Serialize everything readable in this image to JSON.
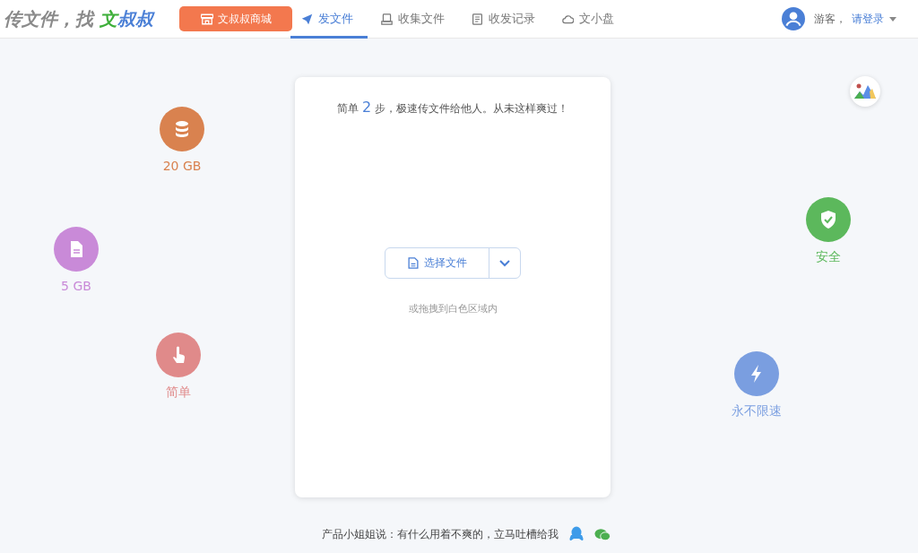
{
  "logo": [
    {
      "text": "传文件，找 ",
      "color": "#8a8a8a"
    },
    {
      "text": "文",
      "color": "#3eaf3a"
    },
    {
      "text": "叔叔",
      "color": "#4a7fd6"
    }
  ],
  "shop_button": {
    "label": "文叔叔商城"
  },
  "tabs": [
    {
      "label": "发文件",
      "selected": true
    },
    {
      "label": "收集文件",
      "selected": false
    },
    {
      "label": "收发记录",
      "selected": false
    },
    {
      "label": "文小盘",
      "selected": false
    }
  ],
  "user": {
    "greeting": "游客，",
    "login": "请登录"
  },
  "features": [
    {
      "label": "20 GB",
      "color": "#d9824f"
    },
    {
      "label": "5 GB",
      "color": "#c98ad8"
    },
    {
      "label": "简单",
      "color": "#e08a8a"
    },
    {
      "label": "安全",
      "color": "#5cb85c"
    },
    {
      "label": "永不限速",
      "color": "#7a9ee0"
    }
  ],
  "upload": {
    "headline_pre": "简单",
    "headline_num": "2",
    "headline_post": "步，极速传文件给他人。从未这样爽过！",
    "choose_button": "选择文件",
    "hint": "或拖拽到白色区域内"
  },
  "footer": {
    "text": "产品小姐姐说：有什么用着不爽的，立马吐槽给我"
  }
}
